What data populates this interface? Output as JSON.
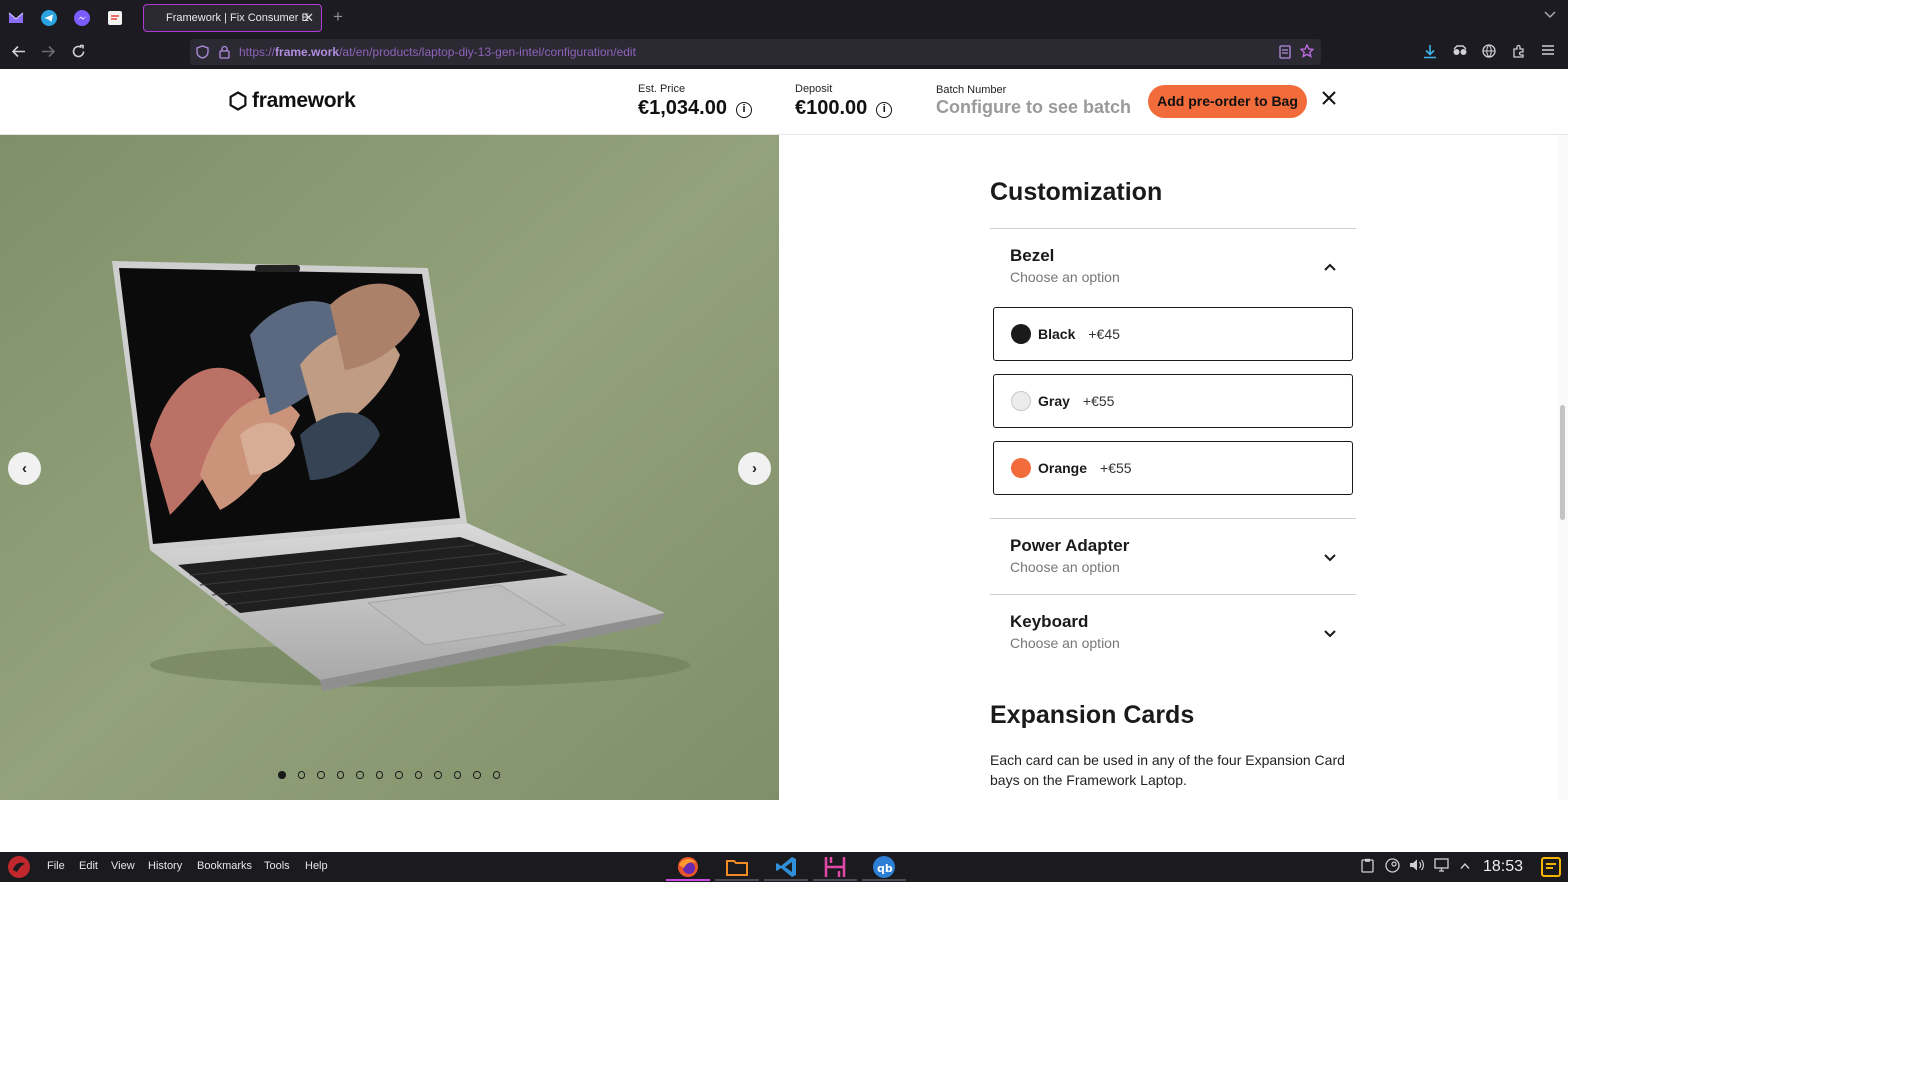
{
  "browser": {
    "tab_title": "Framework | Fix Consumer E",
    "url_host": "frame.work",
    "url_prefix": "https://",
    "url_path": "/at/en/products/laptop-diy-13-gen-intel/configuration/edit"
  },
  "header": {
    "logo_text": "framework",
    "est_price_label": "Est. Price",
    "est_price_value": "€1,034.00",
    "deposit_label": "Deposit",
    "deposit_value": "€100.00",
    "batch_label": "Batch Number",
    "batch_value": "Configure to see batch",
    "cta_label": "Add pre-order to Bag",
    "info_glyph": "i"
  },
  "gallery": {
    "slide_count": 12,
    "active_slide": 1
  },
  "customization": {
    "title": "Customization",
    "sections": [
      {
        "title": "Bezel",
        "subtitle": "Choose an option",
        "expanded": true,
        "options": [
          {
            "name": "Black",
            "price": "+€45",
            "color": "#1a1a1a"
          },
          {
            "name": "Gray",
            "price": "+€55",
            "color": "#ececec"
          },
          {
            "name": "Orange",
            "price": "+€55",
            "color": "#f26b3a"
          }
        ]
      },
      {
        "title": "Power Adapter",
        "subtitle": "Choose an option",
        "expanded": false
      },
      {
        "title": "Keyboard",
        "subtitle": "Choose an option",
        "expanded": false
      }
    ]
  },
  "expansion": {
    "title": "Expansion Cards",
    "description": "Each card can be used in any of the four Expansion Card bays on the Framework Laptop."
  },
  "taskbar": {
    "menu": [
      "File",
      "Edit",
      "View",
      "History",
      "Bookmarks",
      "Tools",
      "Help"
    ],
    "clock": "18:53"
  },
  "colors": {
    "accent": "#f26b3a",
    "gallery_bg": "#8b9b74",
    "browser_bg": "#1c1b22",
    "tab_border": "#b03ad6"
  }
}
